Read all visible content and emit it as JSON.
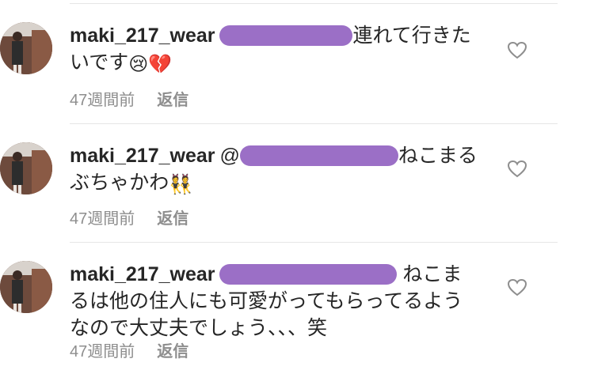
{
  "comments": [
    {
      "username": "maki_217_wear",
      "text_before": "",
      "text_after": "連れて行きたいです",
      "emojis": [
        "😢",
        "💔"
      ],
      "time": "47週間前",
      "reply_label": "返信"
    },
    {
      "username": "maki_217_wear",
      "text_before": "@",
      "text_after": "ねこまるぶちゃかわ",
      "emojis": [
        "👯"
      ],
      "time": "47週間前",
      "reply_label": "返信"
    },
    {
      "username": "maki_217_wear",
      "text_before": "",
      "text_after": " ねこまるは他の住人にも可愛がってもらってるようなので大丈夫でしょう、、、笑",
      "emojis": [],
      "time": "47週間前",
      "reply_label": "返信"
    }
  ],
  "colors": {
    "redaction": "#9b6fc6",
    "meta_text": "#8e8e8e",
    "divider": "#e6e6e6"
  },
  "icons": {
    "like": "heart-outline-icon"
  }
}
